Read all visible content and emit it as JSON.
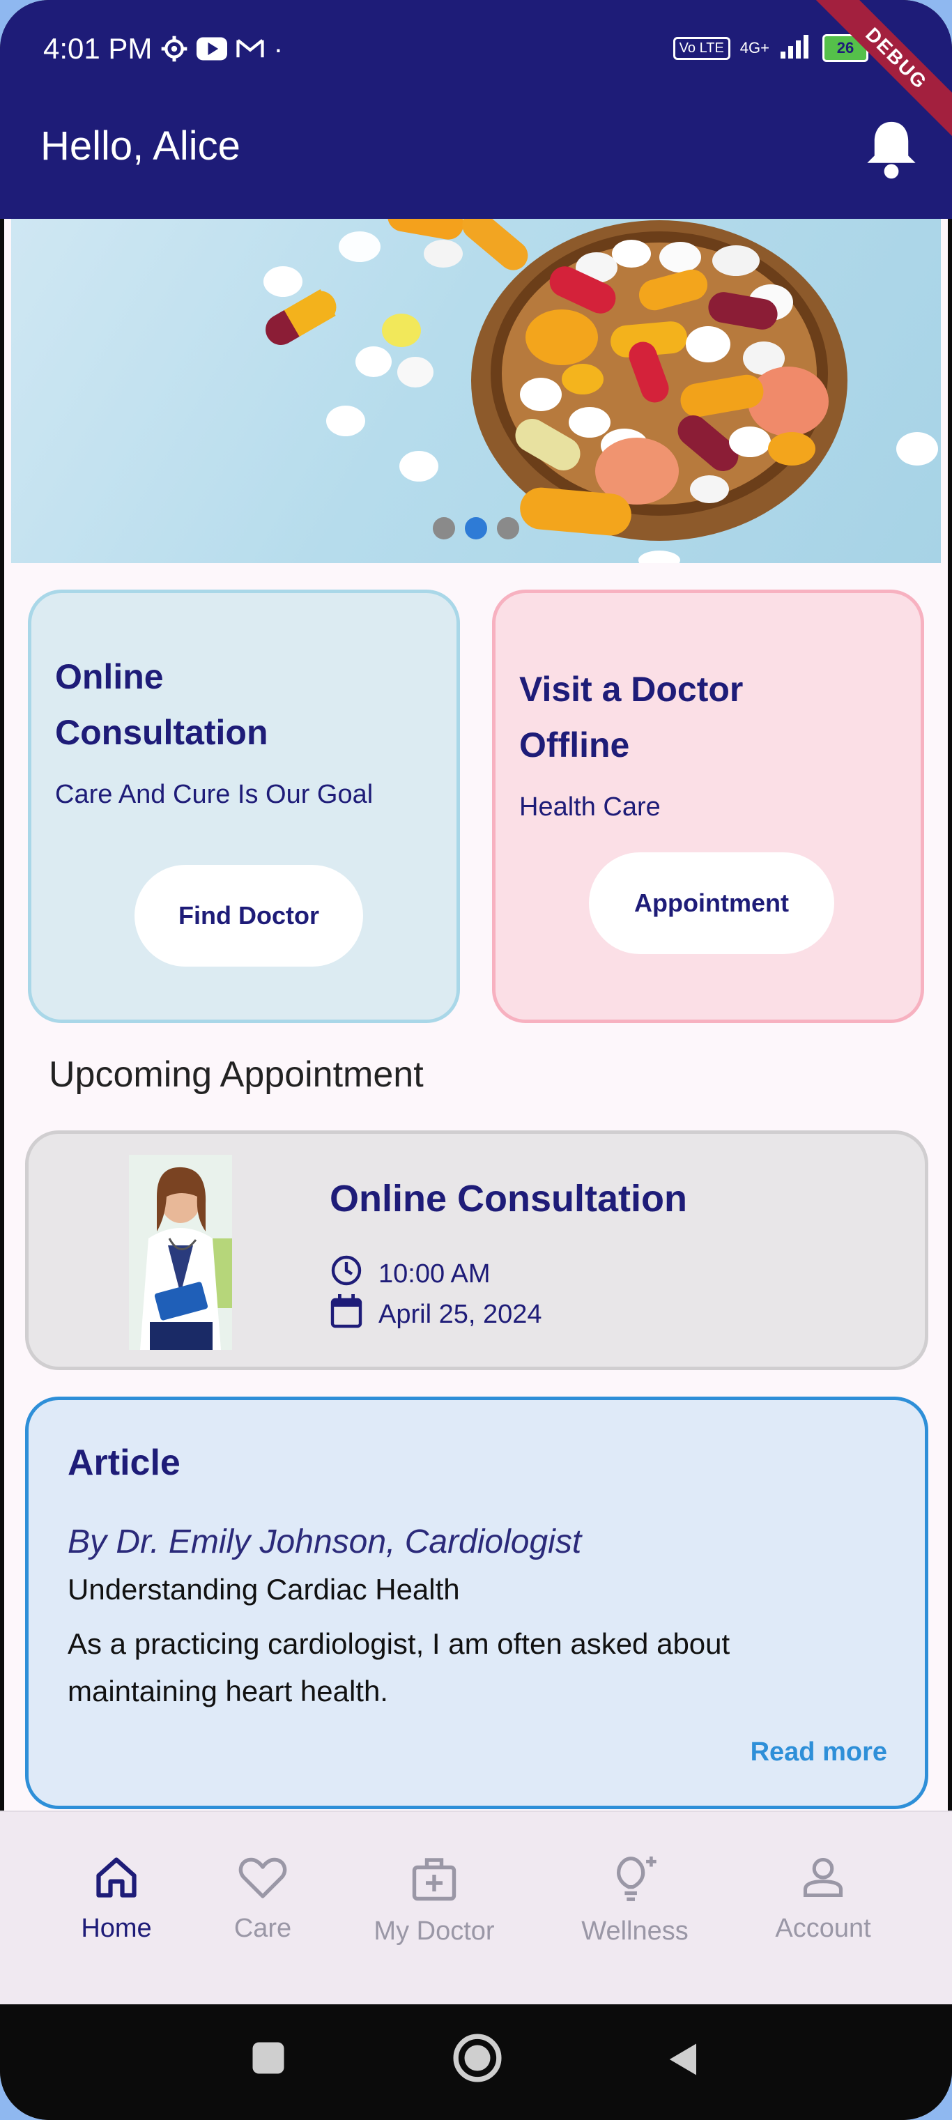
{
  "status_bar": {
    "time": "4:01 PM",
    "icons": [
      "settings-icon",
      "youtube-icon",
      "gmail-icon"
    ],
    "dot": "·",
    "volte": "Vo LTE",
    "network": "4G+",
    "battery": "26",
    "debug_banner": "DEBUG"
  },
  "app_bar": {
    "greeting": "Hello, Alice",
    "notification_icon": "bell-icon"
  },
  "banner": {
    "image": "pills-in-wooden-bowl",
    "carousel_dots": 3,
    "active_dot": 1
  },
  "services": [
    {
      "title_line1": "Online",
      "title_line2": "Consultation",
      "subtitle": "Care And Cure Is Our Goal",
      "button": "Find Doctor"
    },
    {
      "title_line1": "Visit a Doctor",
      "title_line2": "Offline",
      "subtitle": "Health Care",
      "button": "Appointment"
    }
  ],
  "upcoming": {
    "section_title": "Upcoming Appointment",
    "title": "Online Consultation",
    "time": "10:00 AM",
    "date": "April 25, 2024"
  },
  "article": {
    "heading": "Article",
    "author": "By Dr. Emily Johnson, Cardiologist",
    "title": "Understanding Cardiac Health",
    "body": "As a practicing cardiologist, I am often asked about maintaining heart health.",
    "read_more": "Read more"
  },
  "bottom_nav": [
    {
      "label": "Home",
      "icon": "home-icon",
      "active": true
    },
    {
      "label": "Care",
      "icon": "heart-icon",
      "active": false
    },
    {
      "label": "My Doctor",
      "icon": "medical-kit-icon",
      "active": false
    },
    {
      "label": "Wellness",
      "icon": "lightbulb-icon",
      "active": false
    },
    {
      "label": "Account",
      "icon": "person-icon",
      "active": false
    }
  ],
  "colors": {
    "primary": "#1e1c78",
    "accent": "#2e8fd8",
    "card_blue": "#dcebf2",
    "card_pink": "#fbdfe6"
  }
}
